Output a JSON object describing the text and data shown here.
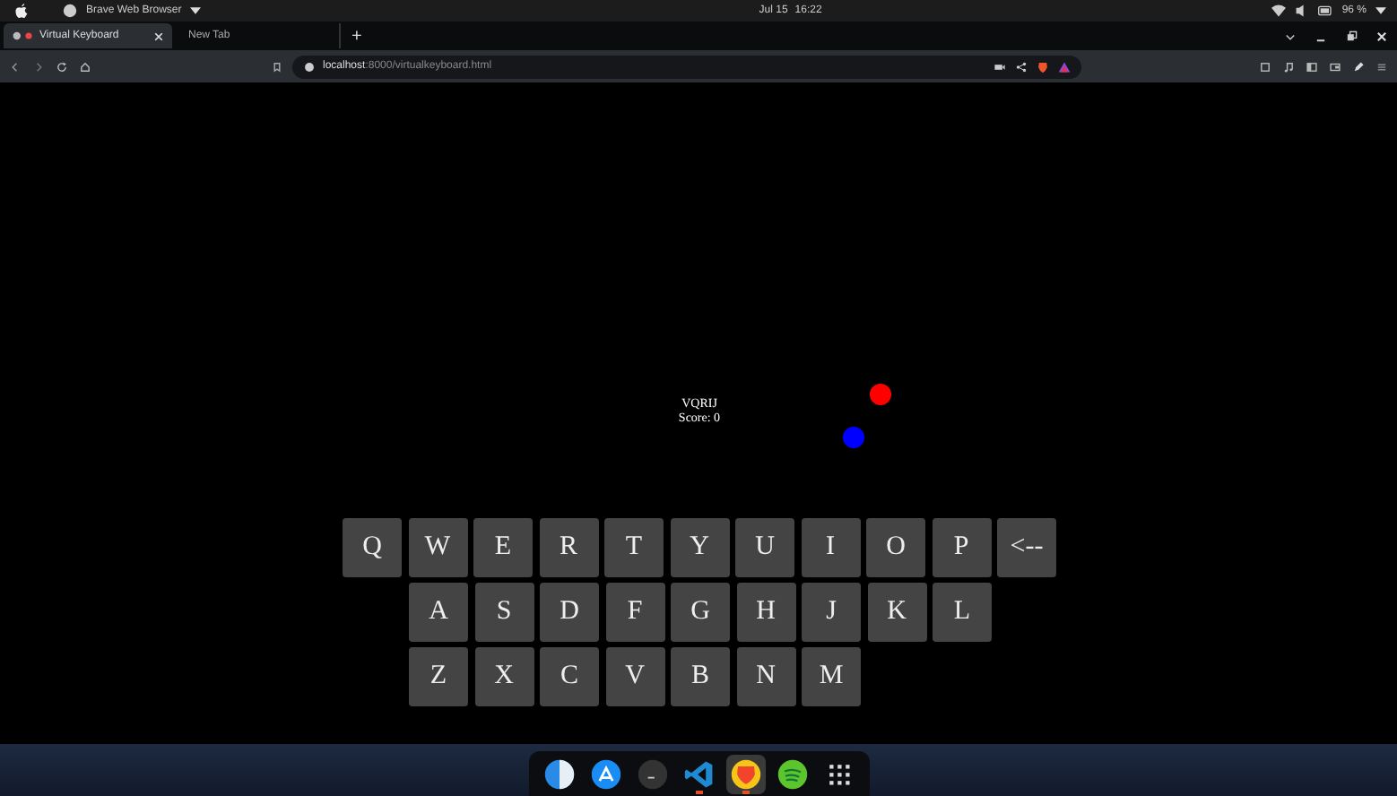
{
  "menubar": {
    "app_name": "Brave Web Browser",
    "date": "Jul 15",
    "time": "16:22",
    "battery": "96 %"
  },
  "tabs": [
    {
      "label": "Virtual Keyboard",
      "selected": true
    },
    {
      "label": "New Tab",
      "selected": false
    }
  ],
  "new_tab": "+",
  "address": {
    "host": "localhost",
    "path": ":8000/virtualkeyboard.html"
  },
  "game": {
    "word": "VQRIJ",
    "score": "Score: 0"
  },
  "keyboard": [
    [
      "Q",
      "W",
      "E",
      "R",
      "T",
      "Y",
      "U",
      "I",
      "O",
      "P",
      "<--"
    ],
    [
      "A",
      "S",
      "D",
      "F",
      "G",
      "H",
      "J",
      "K",
      "L"
    ],
    [
      "Z",
      "X",
      "C",
      "V",
      "B",
      "N",
      "M"
    ]
  ],
  "dock": [
    {
      "kind": "finder",
      "running": false,
      "selected": false
    },
    {
      "kind": "appstore",
      "running": false,
      "selected": false
    },
    {
      "kind": "terminal",
      "running": false,
      "selected": false
    },
    {
      "kind": "code",
      "running": true,
      "selected": false
    },
    {
      "kind": "brave",
      "running": true,
      "selected": true
    },
    {
      "kind": "spotify",
      "running": false,
      "selected": false
    },
    {
      "kind": "grid",
      "running": false,
      "selected": false
    }
  ]
}
